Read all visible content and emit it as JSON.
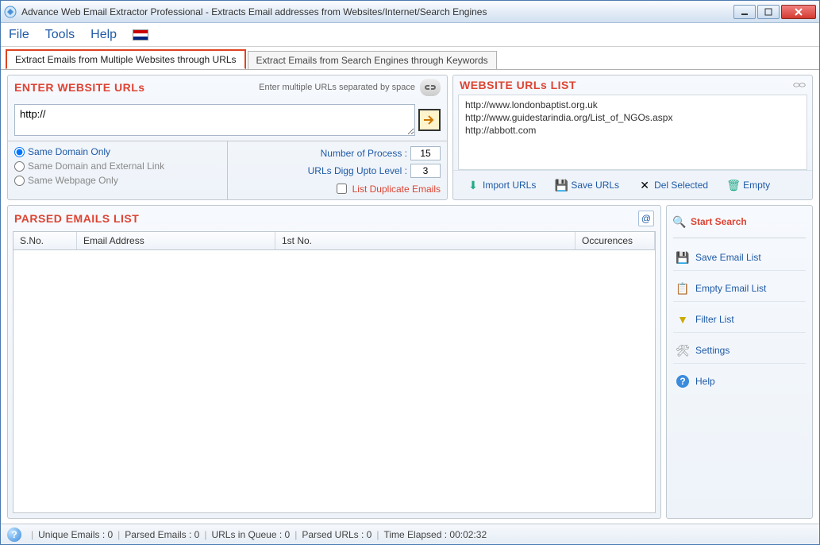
{
  "window": {
    "title": "Advance Web Email Extractor Professional - Extracts Email addresses from Websites/Internet/Search Engines"
  },
  "menubar": {
    "file": "File",
    "tools": "Tools",
    "help": "Help"
  },
  "tabs": {
    "active": "Extract Emails from Multiple Websites through URLs",
    "inactive": "Extract Emails from Search Engines through Keywords"
  },
  "urls_panel": {
    "title": "ENTER WEBSITE URLs",
    "hint": "Enter multiple URLs separated by space",
    "input_value": "http://",
    "radios": {
      "same_domain": "Same Domain Only",
      "same_domain_ext": "Same Domain and External Link",
      "same_webpage": "Same Webpage Only"
    },
    "num_process_label": "Number of Process :",
    "num_process_value": "15",
    "digg_level_label": "URLs Digg Upto Level :",
    "digg_level_value": "3",
    "list_dup": "List Duplicate Emails"
  },
  "list_panel": {
    "title": "WEBSITE URLs LIST",
    "items": [
      "http://www.londonbaptist.org.uk",
      "http://www.guidestarindia.org/List_of_NGOs.aspx",
      "http://abbott.com"
    ],
    "buttons": {
      "import": "Import URLs",
      "save": "Save URLs",
      "del": "Del Selected",
      "empty": "Empty"
    }
  },
  "parsed_panel": {
    "title": "PARSED EMAILS LIST",
    "columns": {
      "sno": "S.No.",
      "email": "Email Address",
      "first": "1st No.",
      "occ": "Occurences"
    }
  },
  "side": {
    "start": "Start Search",
    "save": "Save Email List",
    "empty": "Empty Email List",
    "filter": "Filter List",
    "settings": "Settings",
    "help": "Help"
  },
  "status": {
    "unique": "Unique Emails :  0",
    "parsed": "Parsed Emails :  0",
    "queue": "URLs in Queue :  0",
    "parsed_urls": "Parsed URLs :  0",
    "time": "Time Elapsed :   00:02:32"
  }
}
